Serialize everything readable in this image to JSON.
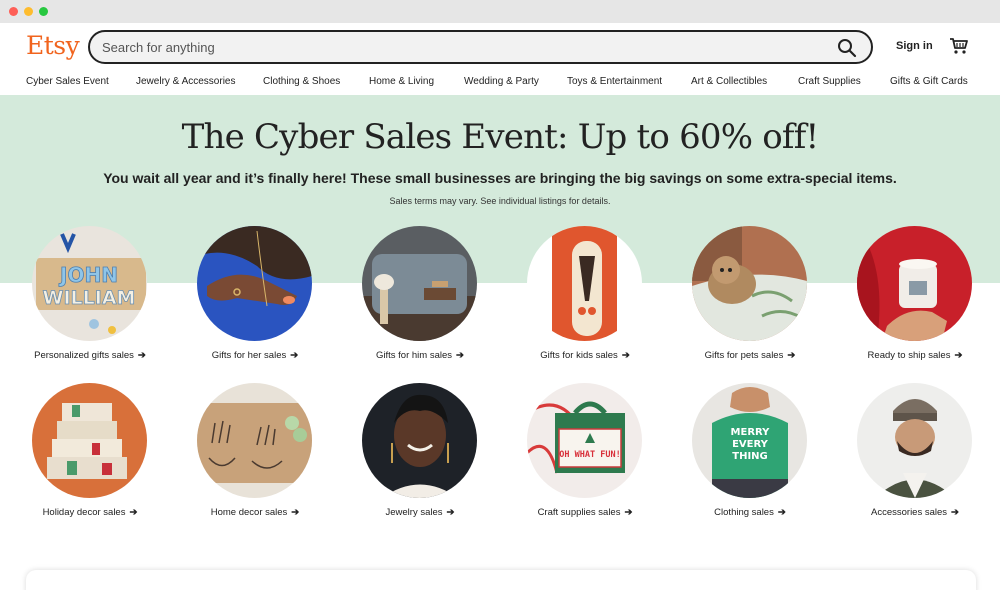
{
  "window": {
    "controls": [
      "close",
      "minimize",
      "maximize"
    ]
  },
  "header": {
    "logo": "Etsy",
    "search_placeholder": "Search for anything",
    "search_icon": "search-icon",
    "signin_label": "Sign in",
    "cart_icon": "cart-icon"
  },
  "nav": {
    "items": [
      "Cyber Sales Event",
      "Jewelry & Accessories",
      "Clothing & Shoes",
      "Home & Living",
      "Wedding & Party",
      "Toys & Entertainment",
      "Art & Collectibles",
      "Craft Supplies",
      "Gifts & Gift Cards"
    ]
  },
  "hero": {
    "title": "The Cyber Sales Event: Up to 60% off!",
    "subtitle": "You wait all year and it’s finally here! These small businesses are bringing the big savings on some extra-special items.",
    "note": "Sales terms may vary. See individual listings for details."
  },
  "categories": [
    {
      "label": "Personalized gifts sales",
      "image_text": [
        "JOHN",
        "WILLIAM"
      ]
    },
    {
      "label": "Gifts for her sales"
    },
    {
      "label": "Gifts for him sales"
    },
    {
      "label": "Gifts for kids sales"
    },
    {
      "label": "Gifts for pets sales"
    },
    {
      "label": "Ready to ship sales"
    },
    {
      "label": "Holiday decor sales"
    },
    {
      "label": "Home decor sales"
    },
    {
      "label": "Jewelry sales"
    },
    {
      "label": "Craft supplies sales",
      "image_text": [
        "OH WHAT FUN!"
      ]
    },
    {
      "label": "Clothing sales",
      "image_text": [
        "MERRY",
        "EVERY",
        "THING"
      ]
    },
    {
      "label": "Accessories sales"
    }
  ],
  "arrow_glyph": "➔",
  "colors": {
    "brand": "#f1641e",
    "hero_bg": "#d4eadb"
  }
}
